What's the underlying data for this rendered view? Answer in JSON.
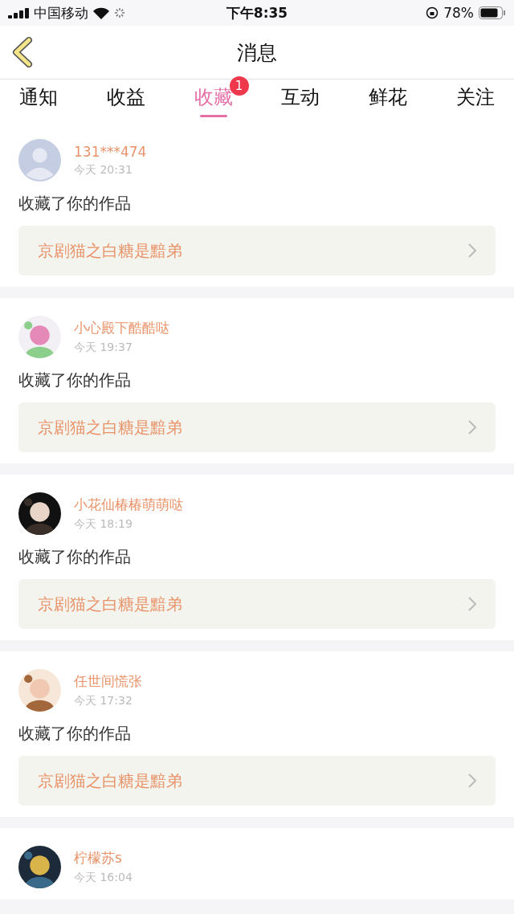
{
  "status_bar": {
    "carrier": "中国移动",
    "time": "下午8:35",
    "battery": "78%"
  },
  "nav": {
    "title": "消息"
  },
  "tabs": [
    {
      "label": "通知",
      "selected": false
    },
    {
      "label": "收益",
      "selected": false
    },
    {
      "label": "收藏",
      "selected": true,
      "badge": "1"
    },
    {
      "label": "互动",
      "selected": false
    },
    {
      "label": "鲜花",
      "selected": false
    },
    {
      "label": "关注",
      "selected": false
    }
  ],
  "messages": [
    {
      "avatar": {
        "kind": "default"
      },
      "name": "131***474",
      "time": "今天 20:31",
      "action": "收藏了你的作品",
      "work": "京剧猫之白糖是黯弟"
    },
    {
      "name": "小心殿下酷酷哒",
      "time": "今天 19:37",
      "action": "收藏了你的作品",
      "work": "京剧猫之白糖是黯弟"
    },
    {
      "name": "小花仙椿椿萌萌哒",
      "time": "今天 18:19",
      "action": "收藏了你的作品",
      "work": "京剧猫之白糖是黯弟"
    },
    {
      "name": "任世间慌张",
      "time": "今天 17:32",
      "action": "收藏了你的作品",
      "work": "京剧猫之白糖是黯弟"
    },
    {
      "name": "柠檬苏s",
      "time": "今天 16:04"
    }
  ]
}
